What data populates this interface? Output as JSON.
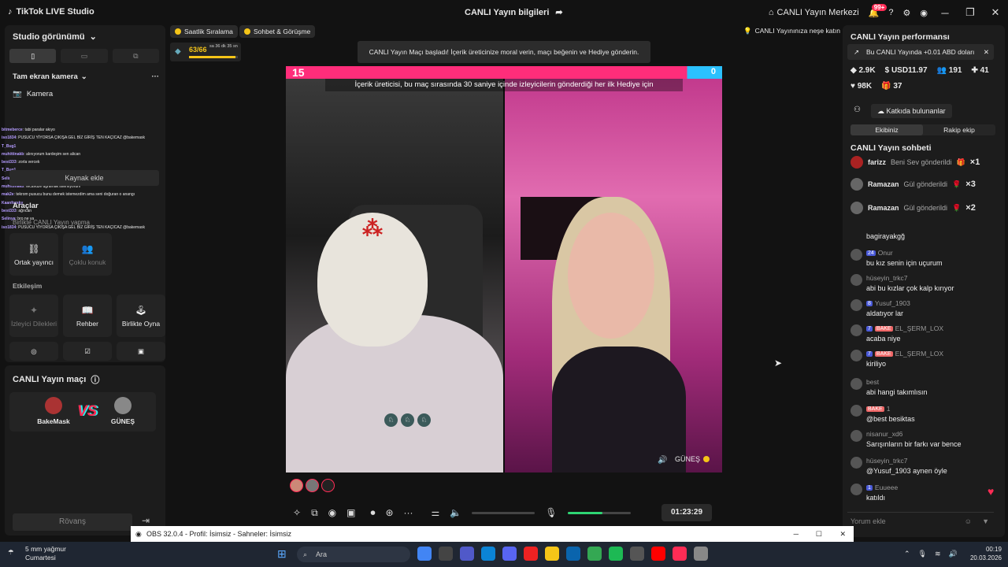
{
  "app": {
    "title": "TikTok LIVE Studio",
    "center_title": "CANLI Yayın bilgileri",
    "center_hub": "CANLI Yayın Merkezi",
    "notif_count": "99+"
  },
  "left": {
    "studio_view": "Studio görünümü",
    "source_title": "Tam ekran kamera",
    "camera": "Camera",
    "kamera_label": "Kamera",
    "add_source": "Kaynak ekle",
    "tools": "Araçlar",
    "overlay_text": "Birlikte CANLI Yayın yapma",
    "tiles_row1": [
      {
        "label": "Ortak yayıncı"
      },
      {
        "label": "Çoklu konuk"
      }
    ],
    "interaction": "Etkileşim",
    "tiles_row2": [
      {
        "label": "İzleyici Dilekleri"
      },
      {
        "label": "Rehber"
      },
      {
        "label": "Birlikte Oyna"
      }
    ],
    "chat_overlay": [
      {
        "user": "bitmeberce",
        "text": ": tabi paralar akıyo"
      },
      {
        "user": "iso1834",
        "text": ": PUSUCU YİYORSA ÇIKIŞA GEL BİZ GİRİŞ TEN KAÇICAZ @bakemask"
      },
      {
        "user": "T_Bug1",
        "text": ""
      },
      {
        "user": "muhittinakb",
        "text": ": alınıyorum kardeşim sen alican"
      },
      {
        "user": "best333",
        "text": ": zorla vercek"
      },
      {
        "user": "T_Bug1",
        "text": ""
      },
      {
        "user": "Selinya",
        "text": ": tekrom başrama özel yapı"
      },
      {
        "user": "muhittinakb",
        "text": ": tecavüze uğramak istemiyorum"
      },
      {
        "user": "mak2e",
        "text": ": tekrom pusucu bunu demek istemezdim ama seni doğuran o anangı"
      },
      {
        "user": "Kaanforsky",
        "text": ""
      },
      {
        "user": "best333",
        "text": ": ağrıcan"
      },
      {
        "user": "Selinya",
        "text": ": bro ne ya"
      },
      {
        "user": "iso1834",
        "text": ": PUSUCU YİYORSA ÇIKIŞA GEL BİZ GİRİŞ TEN KAÇICAZ @bakemask"
      }
    ]
  },
  "match": {
    "title": "CANLI Yayın maçı",
    "player1": "BakeMask",
    "player2": "GÜNEŞ",
    "rematch": "Rövanş"
  },
  "topbar": {
    "pill1": "Saatlik Sıralama",
    "pill2": "Sohbet & Görüşme",
    "rank_progress": "63/66",
    "rank_time": "sa 36 dk 35 sn",
    "toast": "CANLI Yayın Maçı başladı! İçerik üreticinize moral verin, maçı beğenin ve Hediye gönderin.",
    "right_pill": "CANLI Yayınınıza neşe katın"
  },
  "stage": {
    "score_left": "15",
    "score_right": "0",
    "message": "İçerik üreticisi, bu maç sırasında 30 saniye içinde izleyicilerin gönderdiği her ilk Hediye için",
    "right_name": "GÜNEŞ"
  },
  "controls": {
    "timer": "01:23:29",
    "mic_level": 0.55
  },
  "right": {
    "perf_title": "CANLI Yayın performansı",
    "promo": "Bu CANLI Yayında +0.01 ABD doları",
    "stats": {
      "diamonds": "2.9K",
      "usd": "USD11.97",
      "viewers": "191",
      "people": "41",
      "likes": "98K",
      "gifts": "37"
    },
    "contributors": "Katkıda bulunanlar",
    "tab_team": "Ekibiniz",
    "tab_rival": "Rakip ekip",
    "chat_title": "CANLI Yayın sohbeti",
    "gifts": [
      {
        "name": "farizz",
        "text": "Beni Sev gönderildi",
        "count": "×1"
      },
      {
        "name": "Ramazan",
        "text": "Gül gönderildi",
        "count": "×3"
      },
      {
        "name": "Ramazan",
        "text": "Gül gönderildi",
        "count": "×2"
      }
    ],
    "messages": [
      {
        "user": "",
        "level": "",
        "club": "",
        "text": "bagirayakgğ"
      },
      {
        "user": "Onur",
        "level": "24",
        "club": "",
        "text": "bu kız senin için uçurum"
      },
      {
        "user": "hüseyin_trkc7",
        "level": "",
        "club": "",
        "text": "abi bu kızlar çok kalp kırıyor"
      },
      {
        "user": "Yusuf_1903",
        "level": "8",
        "club": "",
        "text": "aldatıyor lar"
      },
      {
        "user": "EL_ŞERM_LOX",
        "level": "7",
        "club": "BAKE",
        "text": "acaba niye"
      },
      {
        "user": "EL_ŞERM_LOX",
        "level": "7",
        "club": "BAKE",
        "text": "kiriliyo"
      },
      {
        "user": "best",
        "level": "",
        "club": "",
        "text": "abi hangi takımlısın"
      },
      {
        "user": "1",
        "level": "",
        "club": "BAKE",
        "text": "@best besiktas"
      },
      {
        "user": "nisanur_xd6",
        "level": "",
        "club": "",
        "text": "Sarışınların bir farkı var bence"
      },
      {
        "user": "hüseyin_trkc7",
        "level": "",
        "club": "",
        "text": "@Yusuf_1903 aynen öyle"
      },
      {
        "user": "Euueee",
        "level": "1",
        "club": "",
        "text": "katıldı"
      }
    ],
    "comment_placeholder": "Yorum ekle"
  },
  "obs": {
    "title": "OBS 32.0.4 - Profil: İsimsiz - Sahneler: İsimsiz"
  },
  "taskbar": {
    "weather_temp": "5 mm yağmur",
    "weather_day": "Cumartesi",
    "search": "Ara",
    "time": "00:19",
    "date": "20.03.2026"
  },
  "colors": {
    "accent": "#fe2c55",
    "cyan": "#25f4ee",
    "green": "#2ed573"
  }
}
